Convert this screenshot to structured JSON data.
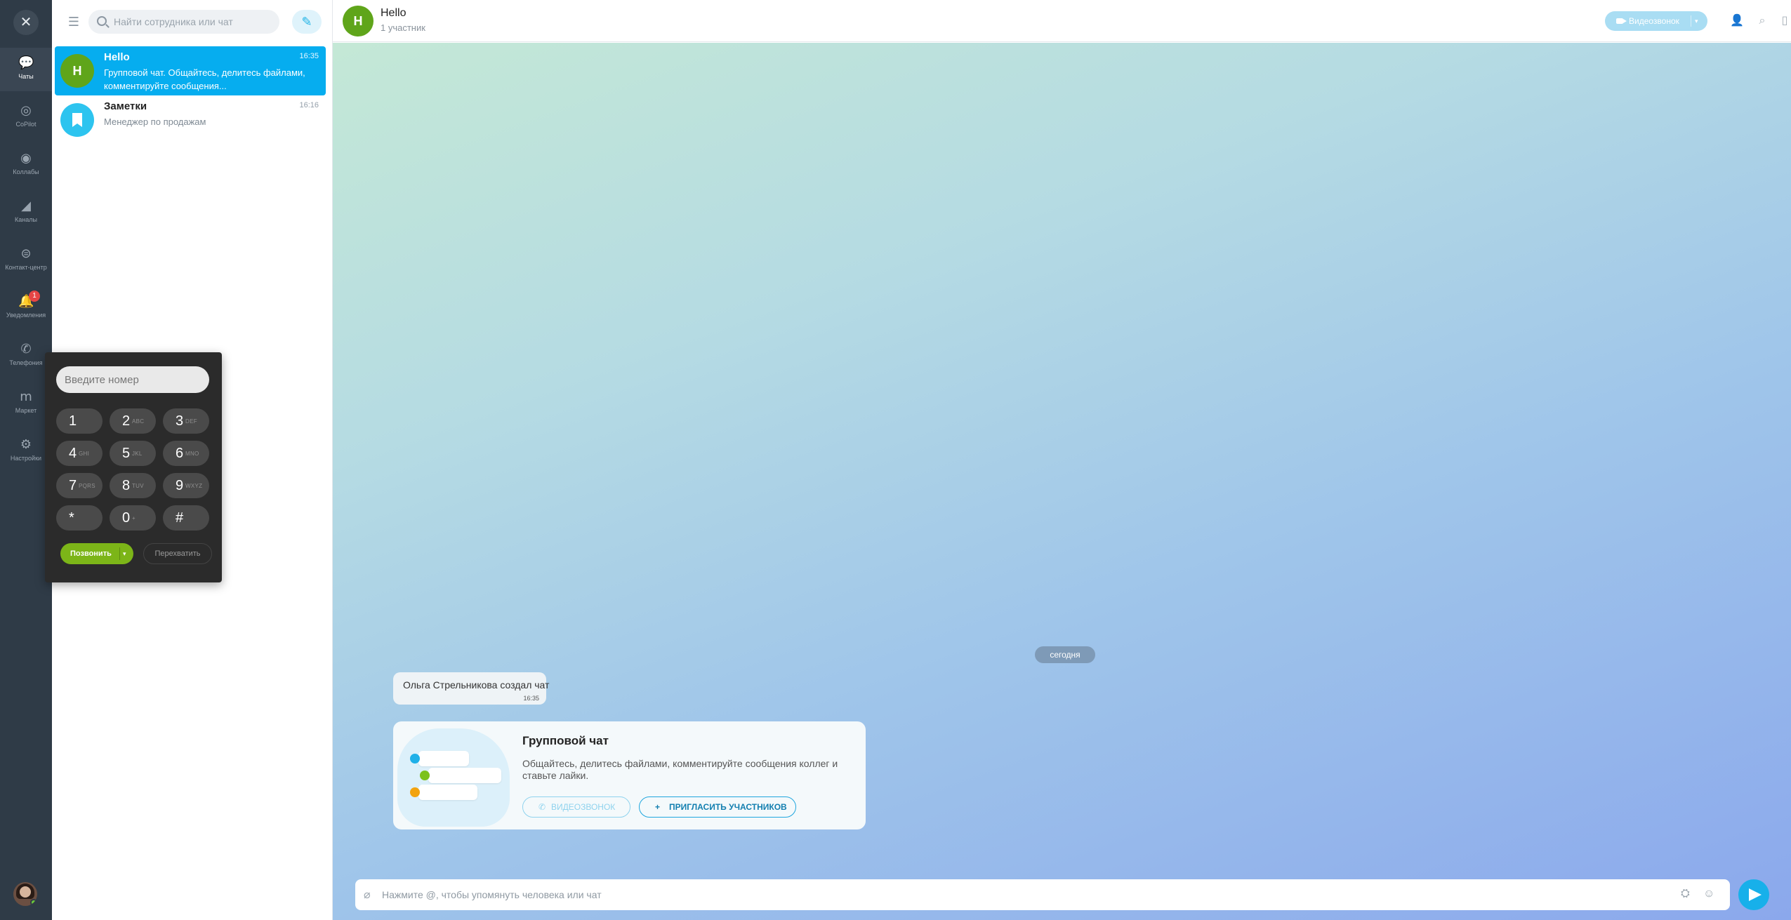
{
  "rail": {
    "items": [
      {
        "label": "Чаты",
        "icon": "chats-icon"
      },
      {
        "label": "CoPilot",
        "icon": "copilot-icon"
      },
      {
        "label": "Коллабы",
        "icon": "collabs-icon"
      },
      {
        "label": "Каналы",
        "icon": "megaphone-icon"
      },
      {
        "label": "Контакт-центр",
        "icon": "contact-center-icon"
      },
      {
        "label": "Уведомления",
        "icon": "bell-icon",
        "badge": "1"
      },
      {
        "label": "Телефония",
        "icon": "phone-icon"
      },
      {
        "label": "Маркет",
        "icon": "market-icon"
      },
      {
        "label": "Настройки",
        "icon": "gear-icon"
      }
    ]
  },
  "search": {
    "placeholder": "Найти сотрудника или чат"
  },
  "chats": [
    {
      "avatar": "H",
      "title": "Hello",
      "time": "16:35",
      "preview": "Групповой чат. Общайтесь, делитесь файлами, комментируйте сообщения...",
      "avatar_color": "#5fa51a"
    },
    {
      "avatar": "",
      "title": "Заметки",
      "time": "16:16",
      "preview": "Менеджер по продажам",
      "avatar_color": "#2dc4ef"
    }
  ],
  "dialpad": {
    "placeholder": "Введите номер",
    "keys": [
      {
        "d": "1",
        "l": ""
      },
      {
        "d": "2",
        "l": "ABC"
      },
      {
        "d": "3",
        "l": "DEF"
      },
      {
        "d": "4",
        "l": "GHI"
      },
      {
        "d": "5",
        "l": "JKL"
      },
      {
        "d": "6",
        "l": "MNO"
      },
      {
        "d": "7",
        "l": "PQRS"
      },
      {
        "d": "8",
        "l": "TUV"
      },
      {
        "d": "9",
        "l": "WXYZ"
      },
      {
        "d": "*",
        "l": ""
      },
      {
        "d": "0",
        "l": "+"
      },
      {
        "d": "#",
        "l": ""
      }
    ],
    "call_label": "Позвонить",
    "transfer_label": "Перехватить"
  },
  "header": {
    "avatar": "H",
    "title": "Hello",
    "subtitle": "1 участник",
    "video_label": "Видеозвонок"
  },
  "chat": {
    "day_label": "сегодня",
    "system_message": "Ольга Стрельникова создал чат",
    "system_time": "16:35",
    "intro": {
      "title": "Групповой чат",
      "description": "Общайтесь, делитесь файлами, комментируйте сообщения коллег и ставьте лайки.",
      "video_button": "Видеозвонок",
      "invite_button": "Пригласить участников"
    }
  },
  "composer": {
    "placeholder": "Нажмите @, чтобы упомянуть человека или чат"
  },
  "colors": {
    "accent": "#06adef",
    "call_green": "#7cb518",
    "rail_bg": "#2f3b47"
  }
}
